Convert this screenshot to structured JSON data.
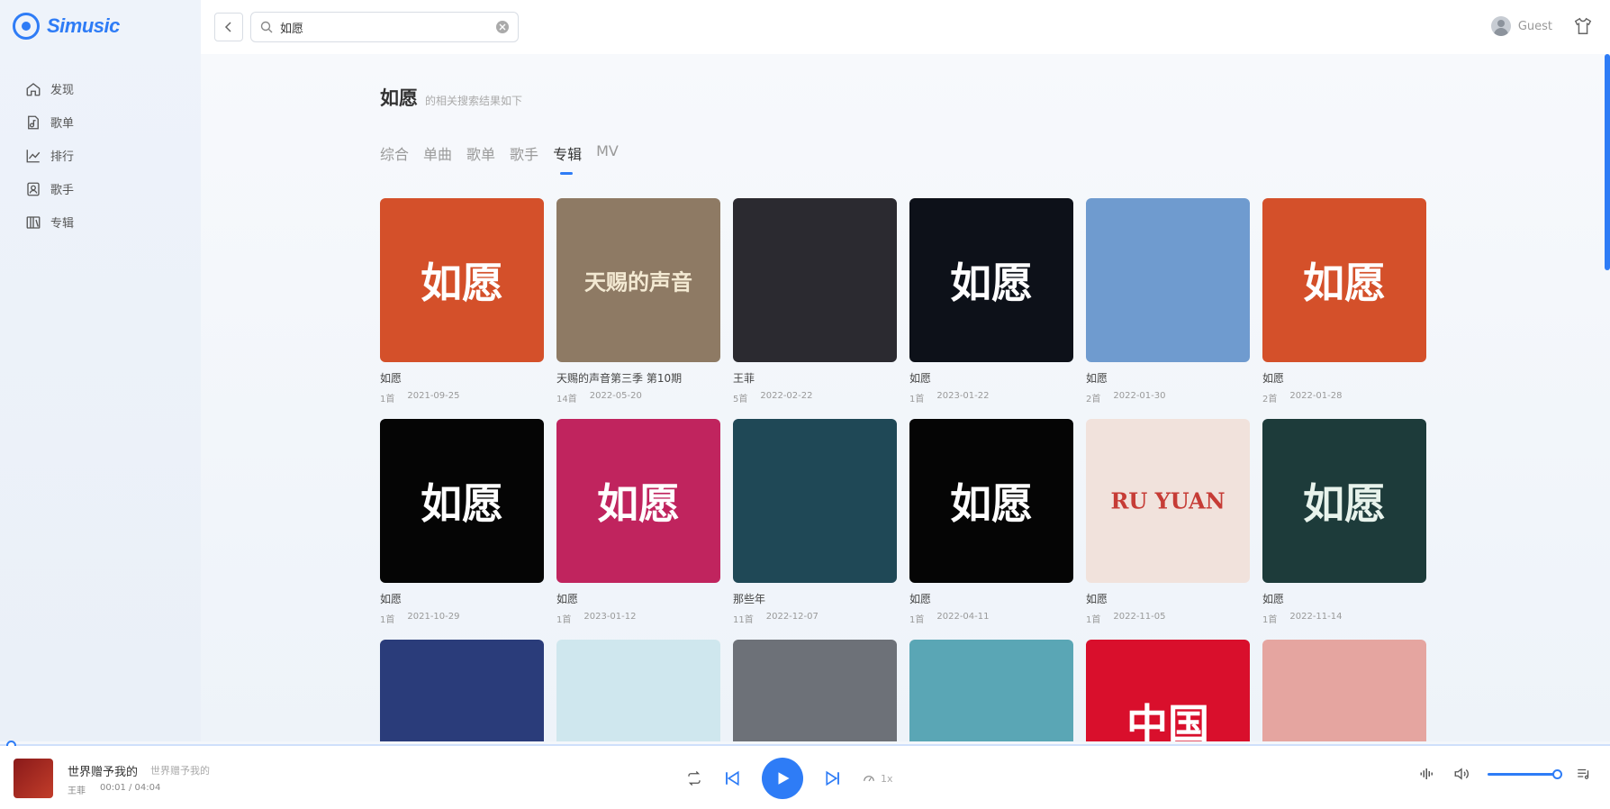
{
  "app": {
    "name": "Simusic"
  },
  "sidebar": {
    "items": [
      {
        "label": "发现",
        "icon": "home-icon"
      },
      {
        "label": "歌单",
        "icon": "playlist-icon"
      },
      {
        "label": "排行",
        "icon": "chart-icon"
      },
      {
        "label": "歌手",
        "icon": "singer-icon"
      },
      {
        "label": "专辑",
        "icon": "album-icon"
      }
    ]
  },
  "header": {
    "search_value": "如愿",
    "user_name": "Guest"
  },
  "results": {
    "keyword": "如愿",
    "subtitle": "的相关搜索结果如下",
    "tabs": [
      "综合",
      "单曲",
      "歌单",
      "歌手",
      "专辑",
      "MV"
    ],
    "active_tab": "专辑"
  },
  "albums": [
    {
      "name": "如愿",
      "count": "1首",
      "date": "2021-09-25",
      "cover_text": "如愿",
      "bg": "#d4502a",
      "fg": "#ffffff"
    },
    {
      "name": "天赐的声音第三季 第10期",
      "count": "14首",
      "date": "2022-05-20",
      "cover_text": "天赐的声音",
      "bg": "#8e7a64",
      "fg": "#f3e9d2"
    },
    {
      "name": "王菲",
      "count": "5首",
      "date": "2022-02-22",
      "cover_text": "",
      "bg": "#2b2a30",
      "fg": "#ffffff"
    },
    {
      "name": "如愿",
      "count": "1首",
      "date": "2023-01-22",
      "cover_text": "如愿",
      "bg": "#0d1119",
      "fg": "#ffffff"
    },
    {
      "name": "如愿",
      "count": "2首",
      "date": "2022-01-30",
      "cover_text": "",
      "bg": "#6f9bcf",
      "fg": "#ffffff"
    },
    {
      "name": "如愿",
      "count": "2首",
      "date": "2022-01-28",
      "cover_text": "如愿",
      "bg": "#d4502a",
      "fg": "#ffffff"
    },
    {
      "name": "如愿",
      "count": "1首",
      "date": "2021-10-29",
      "cover_text": "如愿",
      "bg": "#050505",
      "fg": "#ffffff"
    },
    {
      "name": "如愿",
      "count": "1首",
      "date": "2023-01-12",
      "cover_text": "如愿",
      "bg": "#c0245e",
      "fg": "#ffffff"
    },
    {
      "name": "那些年",
      "count": "11首",
      "date": "2022-12-07",
      "cover_text": "",
      "bg": "#1f4856",
      "fg": "#ffffff"
    },
    {
      "name": "如愿",
      "count": "1首",
      "date": "2022-04-11",
      "cover_text": "如愿",
      "bg": "#050505",
      "fg": "#ffffff"
    },
    {
      "name": "如愿",
      "count": "1首",
      "date": "2022-11-05",
      "cover_text": "RU YUAN",
      "bg": "#f1e2dc",
      "fg": "#c63c36"
    },
    {
      "name": "如愿",
      "count": "1首",
      "date": "2022-11-14",
      "cover_text": "如愿",
      "bg": "#1d3b3a",
      "fg": "#e8f3ec"
    },
    {
      "name": "",
      "count": "",
      "date": "",
      "cover_text": "",
      "bg": "#2a3c7a",
      "fg": "#ffffff"
    },
    {
      "name": "",
      "count": "",
      "date": "",
      "cover_text": "",
      "bg": "#cfe7ee",
      "fg": "#ffffff"
    },
    {
      "name": "",
      "count": "",
      "date": "",
      "cover_text": "",
      "bg": "#6d7178",
      "fg": "#ffffff"
    },
    {
      "name": "",
      "count": "",
      "date": "",
      "cover_text": "",
      "bg": "#5aa6b5",
      "fg": "#ffffff"
    },
    {
      "name": "",
      "count": "",
      "date": "",
      "cover_text": "中国",
      "bg": "#d90f2c",
      "fg": "#ffffff"
    },
    {
      "name": "",
      "count": "",
      "date": "",
      "cover_text": "",
      "bg": "#e5a5a0",
      "fg": "#ffffff"
    }
  ],
  "player": {
    "title": "世界赠予我的",
    "alias": "世界赠予我的",
    "artist": "王菲",
    "time": "00:01 / 04:04",
    "speed": "1x",
    "progress": 0.004,
    "volume": 1.0
  },
  "colors": {
    "accent": "#2e7cf6"
  }
}
